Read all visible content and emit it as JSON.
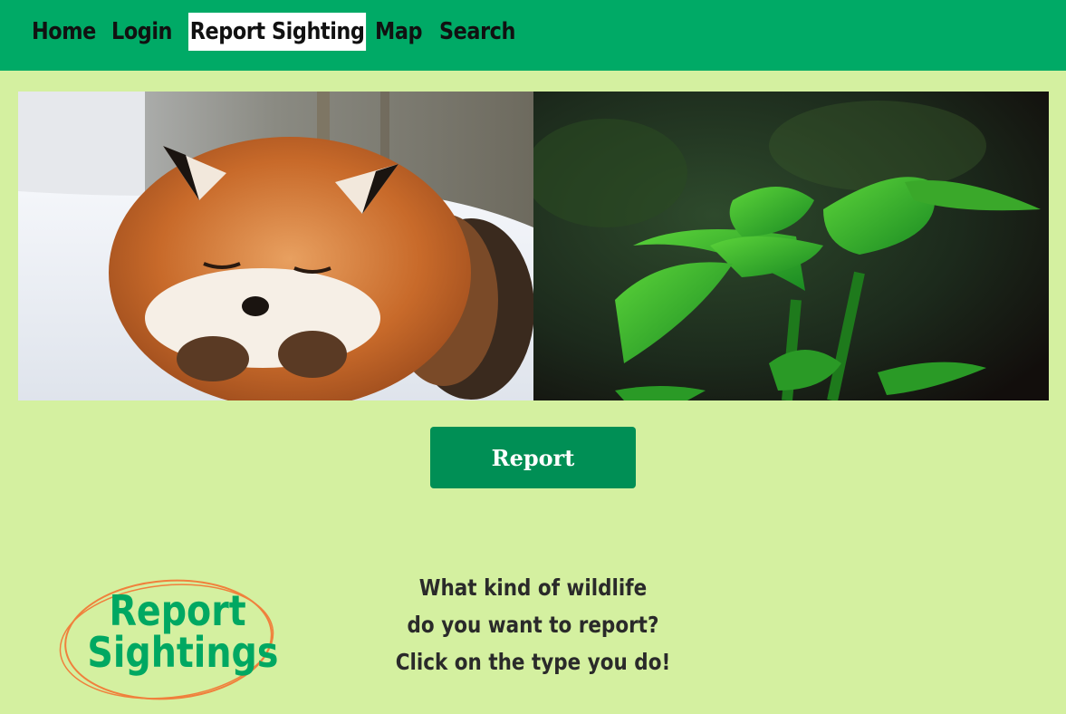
{
  "nav": {
    "items": [
      {
        "label": "Home"
      },
      {
        "label": "Login"
      },
      {
        "label": "Report Sighting"
      },
      {
        "label": "Map"
      },
      {
        "label": "Search"
      }
    ],
    "active": "Report Sighting"
  },
  "hero": {
    "left_image": "sleeping red fox in snow",
    "right_image": "green hosta plant leaves"
  },
  "report_button": {
    "label": "Report"
  },
  "logo": {
    "line1": "Report",
    "line2": "Sightings"
  },
  "prompt": {
    "line1": "What kind of wildlife",
    "line2": "do you want to report?",
    "line3": "Click on the type you do!"
  },
  "colors": {
    "nav_bg": "#00aa66",
    "page_bg": "#d4f0a0",
    "button_bg": "#008f55",
    "logo_text": "#00a862",
    "logo_ring": "#f0803c"
  }
}
